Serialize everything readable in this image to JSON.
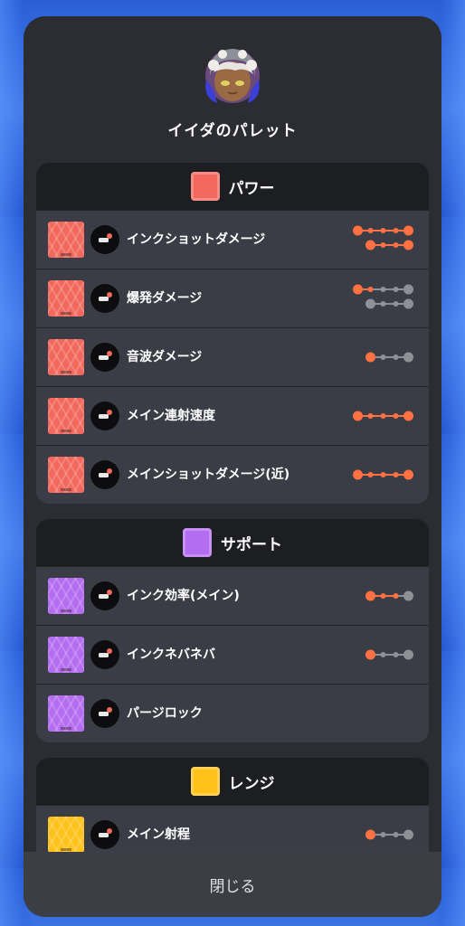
{
  "header": {
    "title": "イイダのパレット",
    "avatar_icon": "character-avatar-icon"
  },
  "colors": {
    "active": "#ff7043",
    "inactive": "#8d9096",
    "power": "#f2685c",
    "support": "#b46cf0",
    "range": "#ffc21a"
  },
  "sections": [
    {
      "title": "パワー",
      "icon": "power-category-icon",
      "chip_color": "#f2685c",
      "rows": [
        {
          "label": "インクショットダメージ",
          "icon": "ink-shot-damage-icon",
          "levels": [
            [
              5,
              5
            ],
            [
              4,
              4
            ]
          ]
        },
        {
          "label": "爆発ダメージ",
          "icon": "explosion-damage-icon",
          "levels": [
            [
              5,
              2
            ],
            [
              4,
              0
            ]
          ]
        },
        {
          "label": "音波ダメージ",
          "icon": "sound-wave-damage-icon",
          "levels": [
            [
              4,
              1
            ]
          ]
        },
        {
          "label": "メイン連射速度",
          "icon": "main-fire-rate-icon",
          "levels": [
            [
              5,
              5
            ]
          ]
        },
        {
          "label": "メインショットダメージ(近)",
          "icon": "main-shot-damage-close-icon",
          "levels": [
            [
              5,
              5
            ]
          ]
        }
      ]
    },
    {
      "title": "サポート",
      "icon": "support-category-icon",
      "chip_color": "#b46cf0",
      "rows": [
        {
          "label": "インク効率(メイン)",
          "icon": "ink-efficiency-main-icon",
          "levels": [
            [
              4,
              3
            ]
          ]
        },
        {
          "label": "インクネバネバ",
          "icon": "sticky-ink-icon",
          "levels": [
            [
              4,
              1
            ]
          ]
        },
        {
          "label": "パージロック",
          "icon": "purge-lock-icon",
          "levels": []
        }
      ]
    },
    {
      "title": "レンジ",
      "icon": "range-category-icon",
      "chip_color": "#ffc21a",
      "rows": [
        {
          "label": "メイン射程",
          "icon": "main-range-icon",
          "levels": [
            [
              4,
              1
            ]
          ]
        }
      ]
    }
  ],
  "footer": {
    "close_label": "閉じる"
  }
}
